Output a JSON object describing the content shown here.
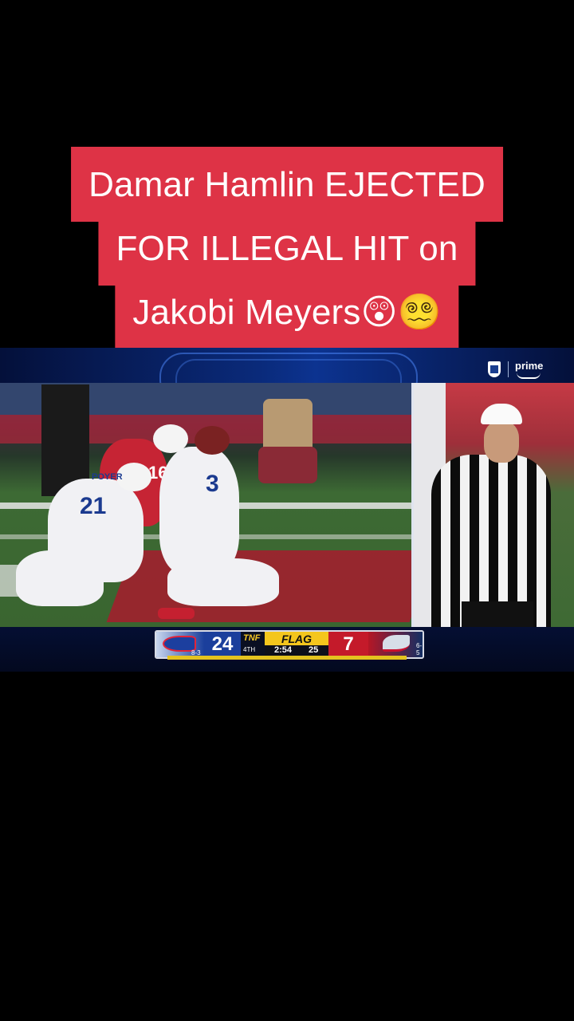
{
  "caption": {
    "line1": "Damar Hamlin EJECTED",
    "line2": "FOR ILLEGAL HIT on",
    "line3": "Jakobi Meyers😲😵‍💫"
  },
  "broadcast": {
    "network_label": "prime",
    "scorebug": {
      "home_score": "24",
      "home_record": "8-3",
      "network_tag": "TNF",
      "quarter": "4TH",
      "status": "FLAG",
      "game_clock": "2:54",
      "play_clock": "25",
      "away_score": "7",
      "away_record": "6-5",
      "colors": {
        "home": "#1b3f9c",
        "away": "#c41a2a",
        "flag": "#f4c61d",
        "caption_bg": "#de3346"
      }
    },
    "players": {
      "left_number": "21",
      "left_name": "POYER",
      "middle_number": "3",
      "opponent_number": "16"
    }
  },
  "icons": [
    "nfl-shield-icon",
    "prime-logo-icon",
    "bills-logo-icon",
    "patriots-logo-icon"
  ]
}
